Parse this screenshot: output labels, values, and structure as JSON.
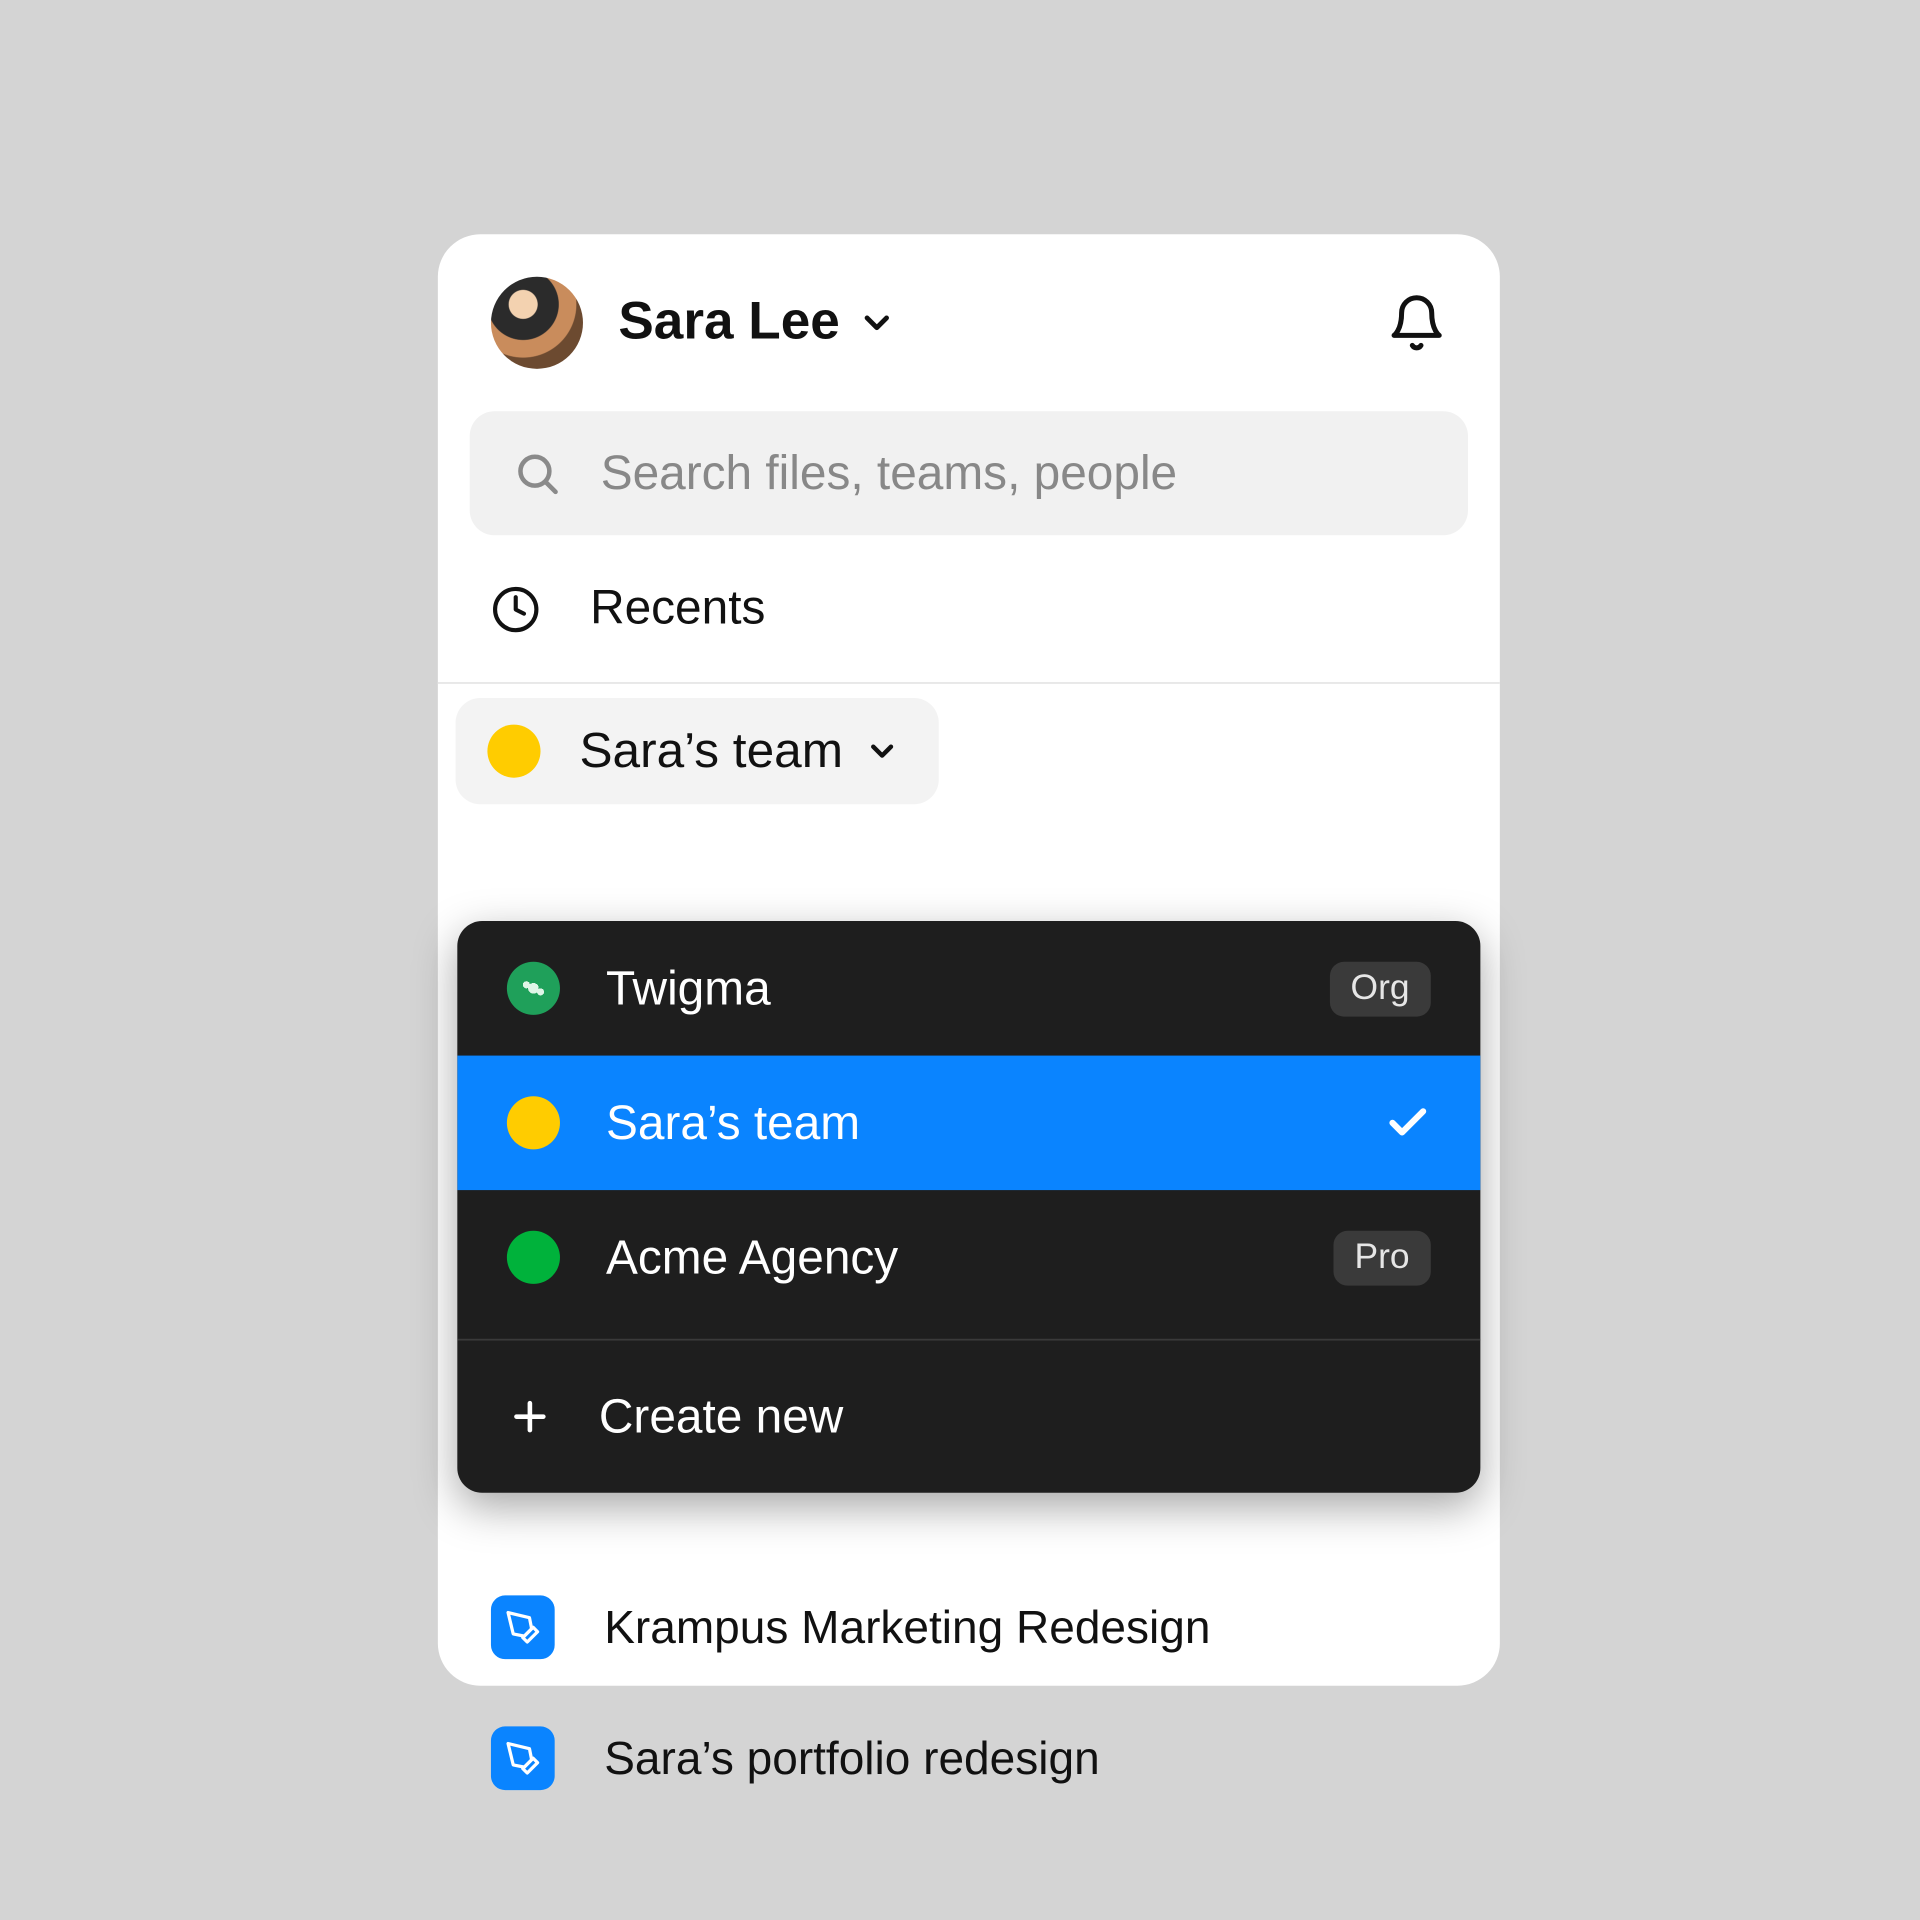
{
  "header": {
    "user_name": "Sara Lee"
  },
  "search": {
    "placeholder": "Search files, teams, people"
  },
  "nav": {
    "recents_label": "Recents"
  },
  "team_selector": {
    "label": "Sara’s team",
    "color": "#ffcc00"
  },
  "dropdown": {
    "items": [
      {
        "label": "Twigma",
        "badge": "Org",
        "selected": false,
        "dot": "green-pat"
      },
      {
        "label": "Sara’s team",
        "badge": "",
        "selected": true,
        "dot": "yellow"
      },
      {
        "label": "Acme Agency",
        "badge": "Pro",
        "selected": false,
        "dot": "green"
      }
    ],
    "create_label": "Create new"
  },
  "files": [
    {
      "label": "Krampus Marketing Redesign"
    },
    {
      "label": "Sara’s portfolio redesign"
    }
  ]
}
